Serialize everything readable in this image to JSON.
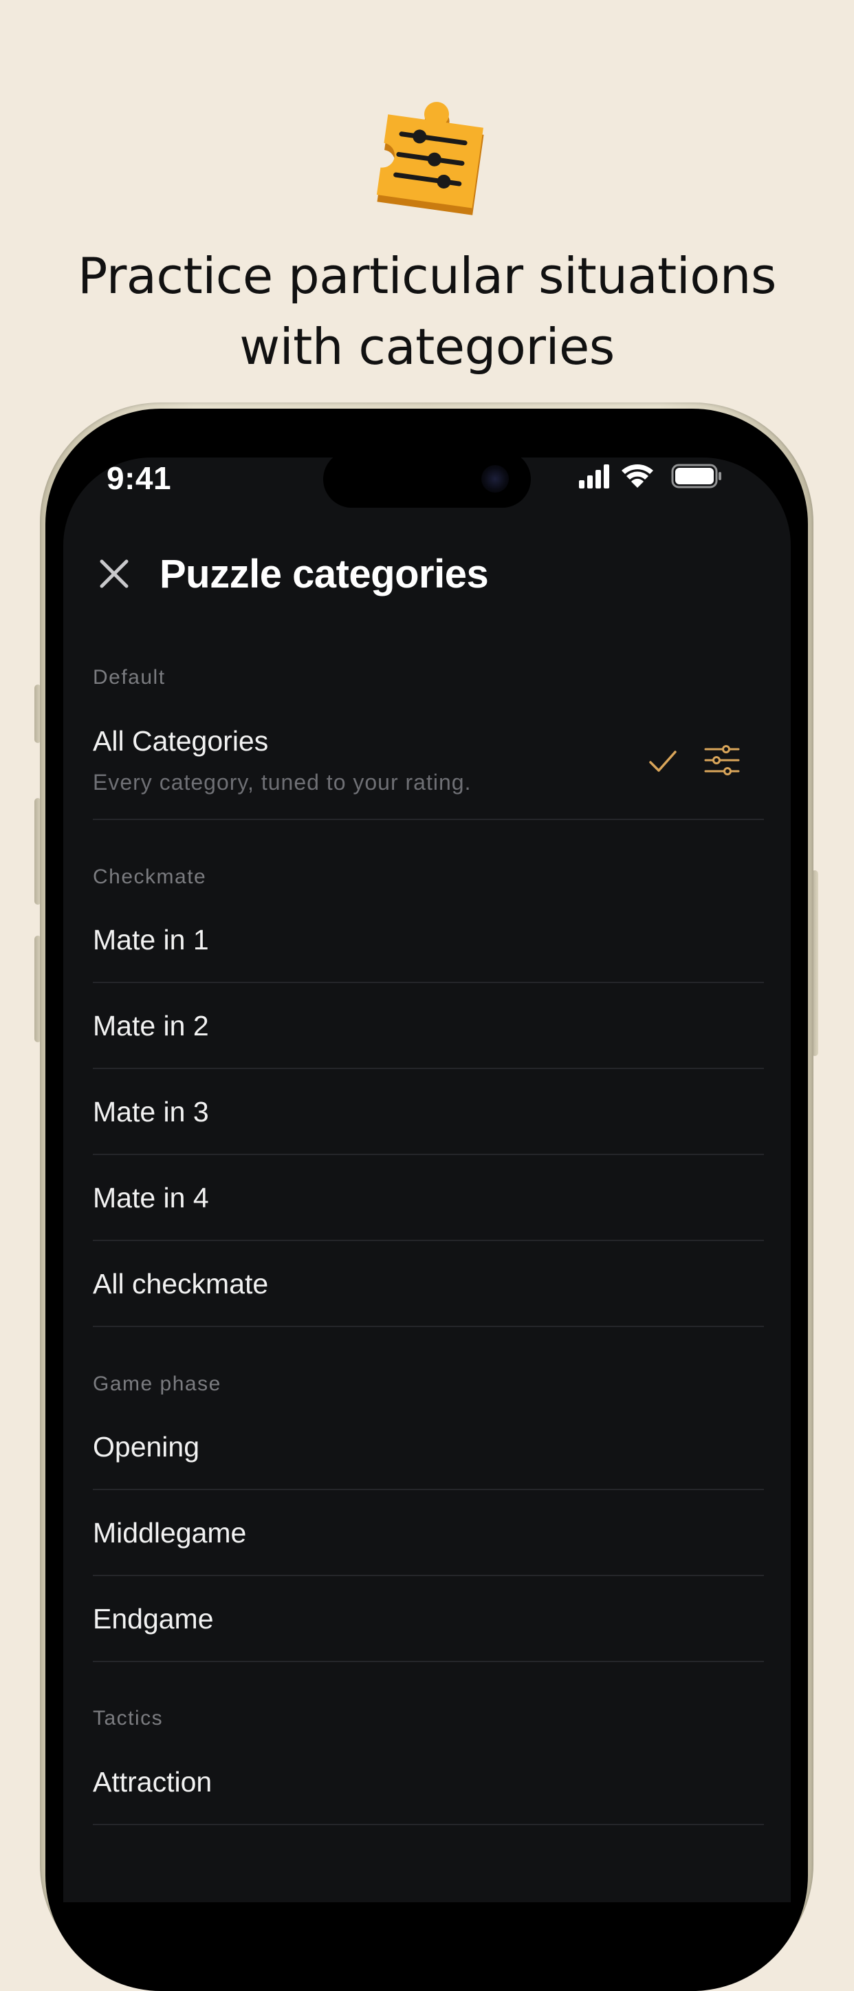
{
  "promo": {
    "headline_line1": "Practice particular situations",
    "headline_line2": "with categories",
    "icon": "puzzle-sliders-icon",
    "icon_color": "#f5a623"
  },
  "status_bar": {
    "time": "9:41",
    "icons": [
      "cellular-signal-icon",
      "wifi-icon",
      "battery-icon"
    ]
  },
  "header": {
    "close_icon": "close-icon",
    "title": "Puzzle categories"
  },
  "colors": {
    "background": "#f2eadd",
    "screen": "#111214",
    "accent": "#d9a55a",
    "section_text": "#7b7c80"
  },
  "sections": {
    "default": {
      "title": "Default",
      "items": [
        {
          "label": "All Categories",
          "subtitle": "Every category, tuned to your rating.",
          "selected": true
        }
      ]
    },
    "checkmate": {
      "title": "Checkmate",
      "items": [
        {
          "label": "Mate in 1"
        },
        {
          "label": "Mate in 2"
        },
        {
          "label": "Mate in 3"
        },
        {
          "label": "Mate in 4"
        },
        {
          "label": "All checkmate"
        }
      ]
    },
    "game_phase": {
      "title": "Game phase",
      "items": [
        {
          "label": "Opening"
        },
        {
          "label": "Middlegame"
        },
        {
          "label": "Endgame"
        }
      ]
    },
    "tactics": {
      "title": "Tactics",
      "items": [
        {
          "label": "Attraction"
        }
      ]
    }
  }
}
